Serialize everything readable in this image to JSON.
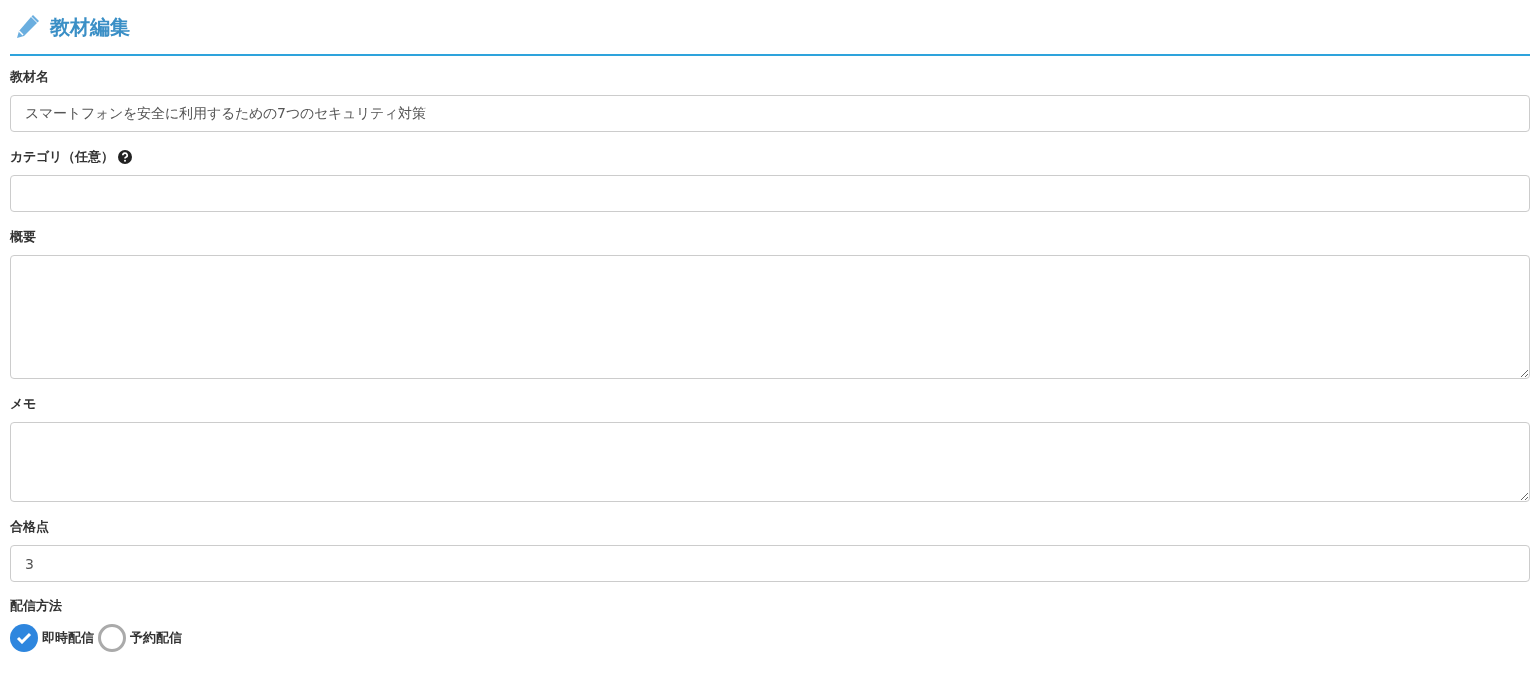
{
  "header": {
    "title": "教材編集"
  },
  "fields": [
    {
      "kind": "input",
      "label": "教材名",
      "value": "スマートフォンを安全に利用するための7つのセキュリティ対策",
      "help": false
    },
    {
      "kind": "input",
      "label": "カテゴリ（任意）",
      "help": true
    },
    {
      "kind": "textarea",
      "label": "概要",
      "help": false
    },
    {
      "kind": "textarea",
      "label": "メモ",
      "help": false
    },
    {
      "kind": "input",
      "label": "合格点",
      "value": "3",
      "help": false
    }
  ],
  "delivery": {
    "label": "配信方法",
    "options": [
      {
        "label": "即時配信",
        "selected": true
      },
      {
        "label": "予約配信",
        "selected": false
      }
    ]
  }
}
